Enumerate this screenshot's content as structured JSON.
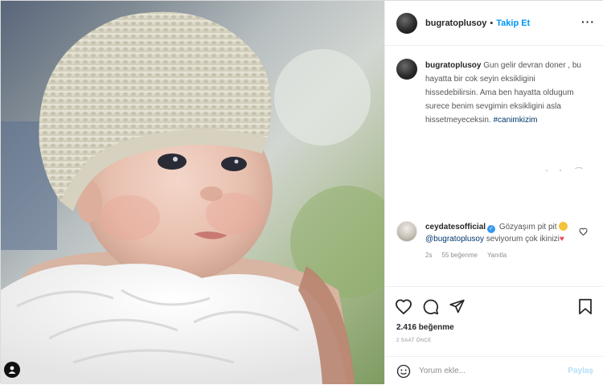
{
  "post": {
    "author": "bugratoplusoy",
    "separator": "•",
    "follow_label": "Takip Et",
    "more_icon": "more-horizontal-icon"
  },
  "caption": {
    "author": "bugratoplusoy",
    "text": "Gun gelir devran doner , bu hayatta bir cok seyin eksikligini hissedebilirsin. Ama ben hayatta oldugum surece benim sevgimin eksikligini asla hissetmeyeceksin.",
    "hashtag": "#canimkizim"
  },
  "comment": {
    "author": "ceydatesofficial",
    "text_before": "Gözyaşım pit pit",
    "mention": "@bugratoplusoy",
    "text_after": "seviyorum çok ikinizi",
    "age": "2s",
    "likes": "55 beğenme",
    "reply_label": "Yanıtla"
  },
  "actions": {
    "like_icon": "heart-icon",
    "comment_icon": "comment-icon",
    "share_icon": "share-icon",
    "save_icon": "bookmark-icon",
    "likes_count": "2.416 beğenme",
    "timestamp": "2 SAAT ÖNCE"
  },
  "add_comment": {
    "emoji_icon": "emoji-icon",
    "placeholder": "Yorum ekle...",
    "post_label": "Paylaş"
  },
  "colors": {
    "accent": "#0095f6",
    "heart": "#ed4956",
    "verified": "#3897f0"
  }
}
